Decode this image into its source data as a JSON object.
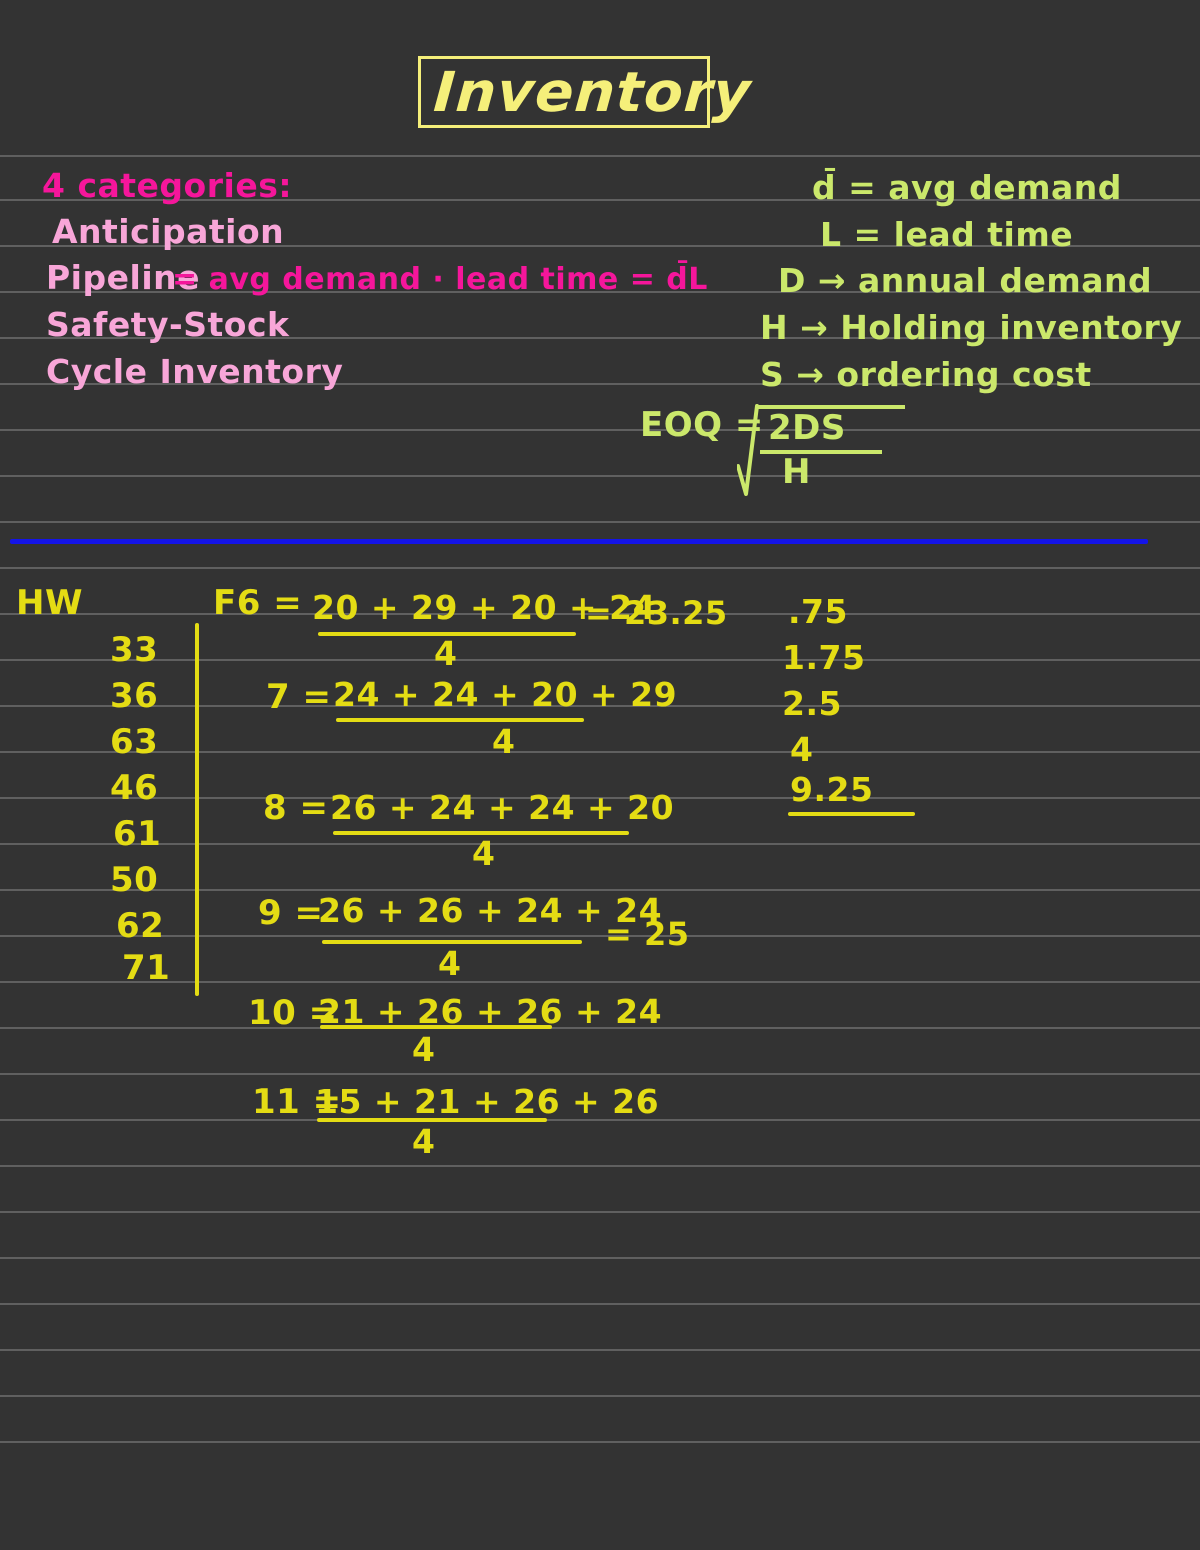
{
  "page": {
    "background_color": "#333333",
    "rule_color": "rgba(255,255,255,0.22)",
    "divider_color": "#1414e8"
  },
  "colors": {
    "title_yellow": "#f5ef7a",
    "hot_pink": "#f5169b",
    "light_pink": "#f8a6d8",
    "yellow_green": "#cbe86b",
    "gold_yellow": "#e4dc14",
    "blue": "#1414e8"
  },
  "title": {
    "text": "Inventory"
  },
  "categories": {
    "heading": "4 categories:",
    "items": [
      {
        "name": "Anticipation",
        "formula": ""
      },
      {
        "name": "Pipeline",
        "formula": "= avg demand · lead time = d̄L"
      },
      {
        "name": "Safety-Stock",
        "formula": ""
      },
      {
        "name": "Cycle Inventory",
        "formula": ""
      }
    ]
  },
  "legend": {
    "entries": [
      "d̄ = avg demand",
      "L = lead time",
      "D → annual demand",
      "H → Holding inventory",
      "S → ordering cost"
    ]
  },
  "eoq": {
    "label": "EOQ =",
    "numerator": "2DS",
    "denominator": "H"
  },
  "homework": {
    "label": "HW",
    "values": [
      "33",
      "36",
      "63",
      "46",
      "61",
      "50",
      "62",
      "71"
    ]
  },
  "forecasts": [
    {
      "label": "F6  =",
      "numerator": "20 + 29 + 20 + 24",
      "denominator": "4",
      "result": "= 23.25"
    },
    {
      "label": "7 =",
      "numerator": "24 + 24 + 20 + 29",
      "denominator": "4",
      "result": ""
    },
    {
      "label": "8 =",
      "numerator": "26 + 24 + 24 + 20",
      "denominator": "4",
      "result": ""
    },
    {
      "label": "9 =",
      "numerator": "26 + 26 + 24 + 24",
      "denominator": "4",
      "result": "= 25"
    },
    {
      "label": "10 =",
      "numerator": "21 + 26 + 26 + 24",
      "denominator": "4",
      "result": ""
    },
    {
      "label": "11 =",
      "numerator": "15 + 21 + 26 + 26",
      "denominator": "4",
      "result": ""
    }
  ],
  "results_column": {
    "values": [
      ".75",
      "1.75",
      "2.5",
      "4",
      "9.25"
    ]
  }
}
